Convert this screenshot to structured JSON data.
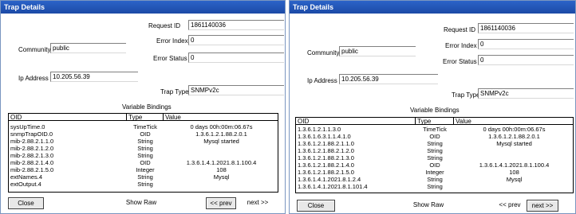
{
  "colors": {
    "titlebar": "#2c63c8",
    "titlebar_text": "#ffffff",
    "border": "#7a96c0",
    "button_face": "#e8e8e8"
  },
  "left": {
    "title": "Trap Details",
    "request_id_label": "Request ID",
    "request_id": "1861140036",
    "error_index_label": "Error Index",
    "error_index": "0",
    "error_status_label": "Error Status",
    "error_status": "0",
    "community_label": "Community",
    "community": "public",
    "ip_label": "Ip Address",
    "ip": "10.205.56.39",
    "trap_type_label": "Trap Type",
    "trap_type": "SNMPv2c",
    "vb_title": "Variable Bindings",
    "headers": {
      "oid": "OID",
      "type": "Type",
      "value": "Value"
    },
    "rows": [
      {
        "oid": "sysUpTime.0",
        "type": "TimeTick",
        "value": "0 days 00h:00m:06.67s"
      },
      {
        "oid": "snmpTrapOID.0",
        "type": "OID",
        "value": "1.3.6.1.2.1.88.2.0.1"
      },
      {
        "oid": "mib-2.88.2.1.1.0",
        "type": "String",
        "value": "Mysql started"
      },
      {
        "oid": "mib-2.88.2.1.2.0",
        "type": "String",
        "value": ""
      },
      {
        "oid": "mib-2.88.2.1.3.0",
        "type": "String",
        "value": ""
      },
      {
        "oid": "mib-2.88.2.1.4.0",
        "type": "OID",
        "value": "1.3.6.1.4.1.2021.8.1.100.4"
      },
      {
        "oid": "mib-2.88.2.1.5.0",
        "type": "Integer",
        "value": "108"
      },
      {
        "oid": "extNames.4",
        "type": "String",
        "value": "Mysql"
      },
      {
        "oid": "extOutput.4",
        "type": "String",
        "value": ""
      }
    ],
    "buttons": {
      "close": "Close",
      "show_raw": "Show Raw",
      "prev": "<< prev",
      "next": "next >>"
    }
  },
  "right": {
    "title": "Trap Details",
    "request_id_label": "Request ID",
    "request_id": "1861140036",
    "error_index_label": "Error Index",
    "error_index": "0",
    "error_status_label": "Error Status",
    "error_status": "0",
    "community_label": "Community",
    "community": "public",
    "ip_label": "Ip Address",
    "ip": "10.205.56.39",
    "trap_type_label": "Trap Type",
    "trap_type": "SNMPv2c",
    "vb_title": "Variable Bindings",
    "headers": {
      "oid": "OID",
      "type": "Type",
      "value": "Value"
    },
    "rows": [
      {
        "oid": "1.3.6.1.2.1.1.3.0",
        "type": "TimeTick",
        "value": "0 days 00h:00m:06.67s"
      },
      {
        "oid": "1.3.6.1.6.3.1.1.4.1.0",
        "type": "OID",
        "value": "1.3.6.1.2.1.88.2.0.1"
      },
      {
        "oid": "1.3.6.1.2.1.88.2.1.1.0",
        "type": "String",
        "value": "Mysql started"
      },
      {
        "oid": "1.3.6.1.2.1.88.2.1.2.0",
        "type": "String",
        "value": ""
      },
      {
        "oid": "1.3.6.1.2.1.88.2.1.3.0",
        "type": "String",
        "value": ""
      },
      {
        "oid": "1.3.6.1.2.1.88.2.1.4.0",
        "type": "OID",
        "value": "1.3.6.1.4.1.2021.8.1.100.4"
      },
      {
        "oid": "1.3.6.1.2.1.88.2.1.5.0",
        "type": "Integer",
        "value": "108"
      },
      {
        "oid": "1.3.6.1.4.1.2021.8.1.2.4",
        "type": "String",
        "value": "Mysql"
      },
      {
        "oid": "1.3.6.1.4.1.2021.8.1.101.4",
        "type": "String",
        "value": ""
      }
    ],
    "buttons": {
      "close": "Close",
      "show_raw": "Show Raw",
      "prev": "<< prev",
      "next": "next >>"
    }
  }
}
